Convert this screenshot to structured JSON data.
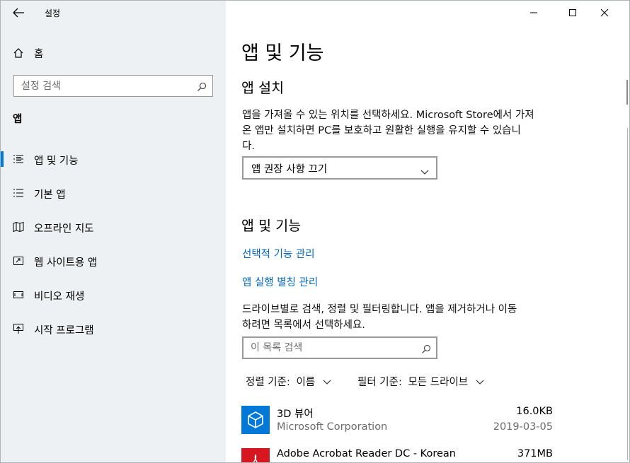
{
  "window": {
    "title": "설정",
    "back_icon": "back-arrow-icon",
    "minimize_icon": "minimize-icon",
    "maximize_icon": "maximize-icon",
    "close_icon": "close-icon"
  },
  "sidebar": {
    "home_label": "홈",
    "search_placeholder": "설정 검색",
    "section_title": "앱",
    "items": [
      {
        "label": "앱 및 기능",
        "icon": "list-icon",
        "selected": true
      },
      {
        "label": "기본 앱",
        "icon": "list-icon",
        "selected": false
      },
      {
        "label": "오프라인 지도",
        "icon": "map-icon",
        "selected": false
      },
      {
        "label": "웹 사이트용 앱",
        "icon": "open-in-window-icon",
        "selected": false
      },
      {
        "label": "비디오 재생",
        "icon": "video-icon",
        "selected": false
      },
      {
        "label": "시작 프로그램",
        "icon": "startup-icon",
        "selected": false
      }
    ]
  },
  "main": {
    "page_title": "앱 및 기능",
    "install_heading": "앱 설치",
    "install_desc_line1": "앱을 가져올 수 있는 위치를 선택하세요. Microsoft Store에서 가져",
    "install_desc_line2": "온 앱만 설치하면 PC를 보호하고 원활한 실행을 유지할 수 있습니",
    "install_desc_line3": "다.",
    "install_dropdown_value": "앱 권장 사항 끄기",
    "apps_heading": "앱 및 기능",
    "link_optional_features": "선택적 기능 관리",
    "link_app_aliases": "앱 실행 별칭 관리",
    "filter_desc_line1": "드라이브별로 검색, 정렬 및 필터링합니다. 앱을 제거하거나 이동",
    "filter_desc_line2": "하려면 목록에서 선택하세요.",
    "list_search_placeholder": "이 목록 검색",
    "sort_label": "정렬 기준:",
    "sort_value": "이름",
    "filter_label": "필터 기준:",
    "filter_value": "모든 드라이브",
    "apps": [
      {
        "name": "3D 뷰어",
        "publisher": "Microsoft Corporation",
        "size": "16.0KB",
        "date": "2019-03-05",
        "icon": "cube-icon",
        "color": "#0078d7"
      },
      {
        "name": "Adobe Acrobat Reader DC - Korean",
        "publisher": "",
        "size": "371MB",
        "date": "",
        "icon": "acrobat-icon",
        "color": "#d7171f"
      }
    ]
  },
  "colors": {
    "accent": "#0078d7",
    "link": "#0067c0",
    "sidebar_bg": "#eef1f3"
  }
}
